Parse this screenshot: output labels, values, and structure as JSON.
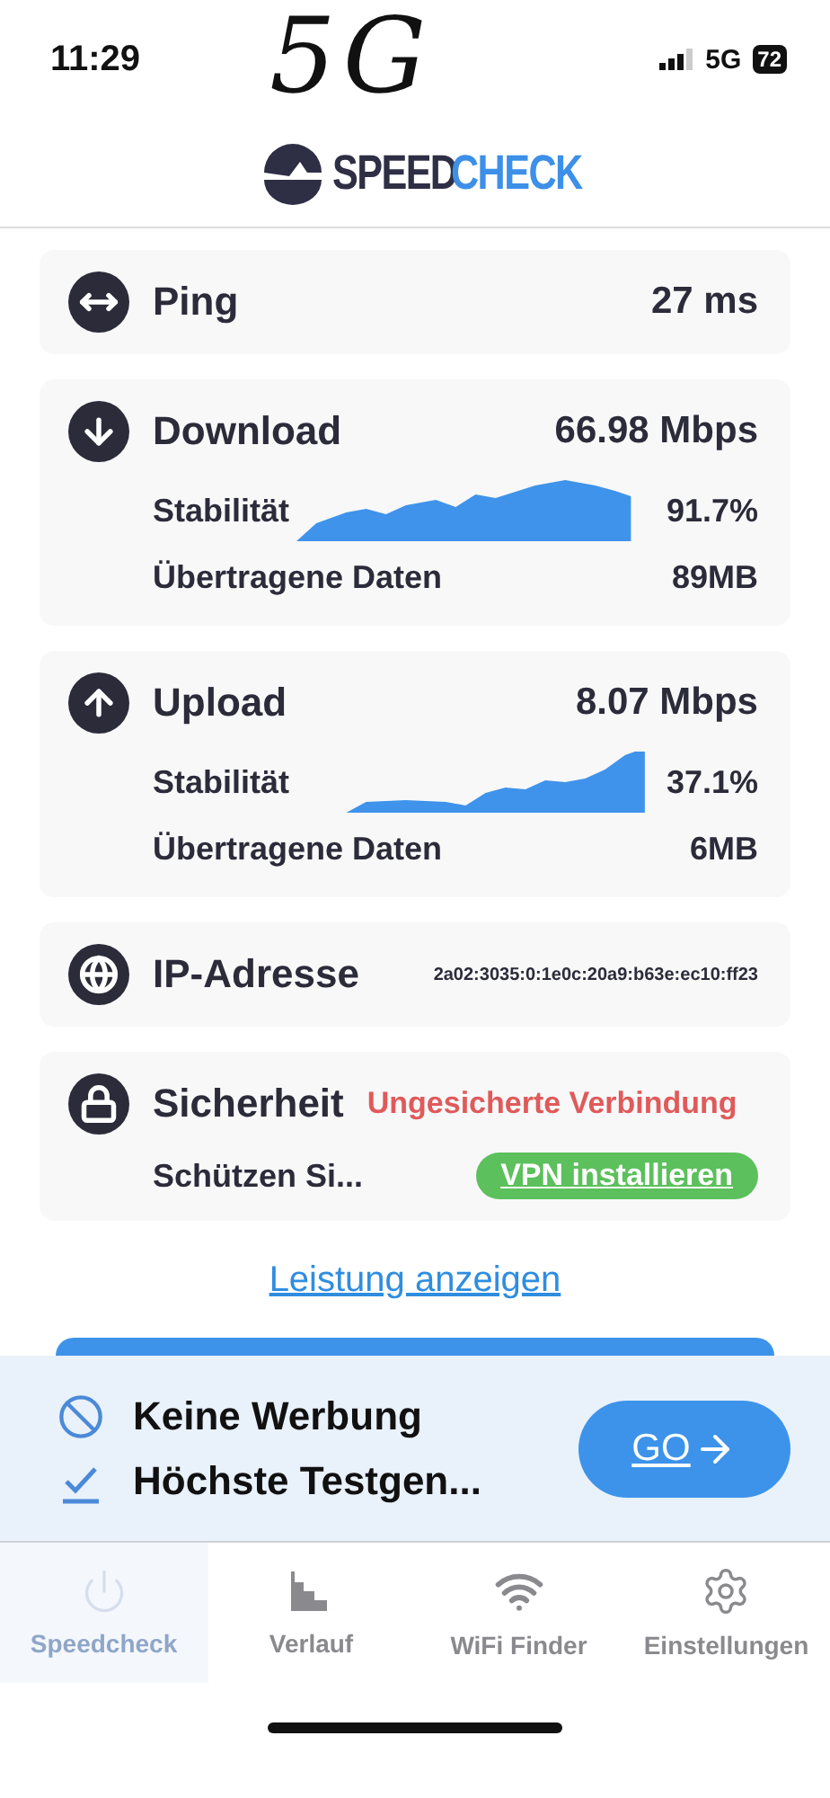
{
  "status_bar": {
    "time": "11:29",
    "network": "5G",
    "battery": "72"
  },
  "annotation": {
    "text": "5G"
  },
  "logo": {
    "part_1": "SPEED",
    "part_2": "CHECK"
  },
  "results": [
    {
      "kind": "simple",
      "label": "Ping",
      "value": "27 ms"
    },
    {
      "kind": "transfer",
      "label": "Download",
      "value": "66.98 Mbps",
      "stability_label": "Stabilität",
      "stability": "91.7%",
      "data_label": "Übertragene Daten",
      "data": "89MB"
    },
    {
      "kind": "transfer",
      "label": "Upload",
      "value": "8.07 Mbps",
      "stability_label": "Stabilität",
      "stability": "37.1%",
      "data_label": "Übertragene Daten",
      "data": "6MB"
    },
    {
      "kind": "ip",
      "label": "IP-Adresse",
      "value": "2a02:3035:0:1e0c:20a9:b63e:ec10:ff23"
    },
    {
      "kind": "security",
      "label": "Sicherheit",
      "status": "Ungesicherte Verbindung",
      "hint": "Schützen Si...",
      "action": "VPN installieren"
    }
  ],
  "link": "Leistung anzeigen",
  "promo": {
    "features": [
      "Keine Werbung",
      "Höchste Testgen..."
    ],
    "button": "GO"
  },
  "nav": [
    {
      "label": "Speedcheck",
      "selected": true
    },
    {
      "label": "Verlauf",
      "selected": false
    },
    {
      "label": "WiFi Finder",
      "selected": false
    },
    {
      "label": "Einstellungen",
      "selected": false
    }
  ]
}
